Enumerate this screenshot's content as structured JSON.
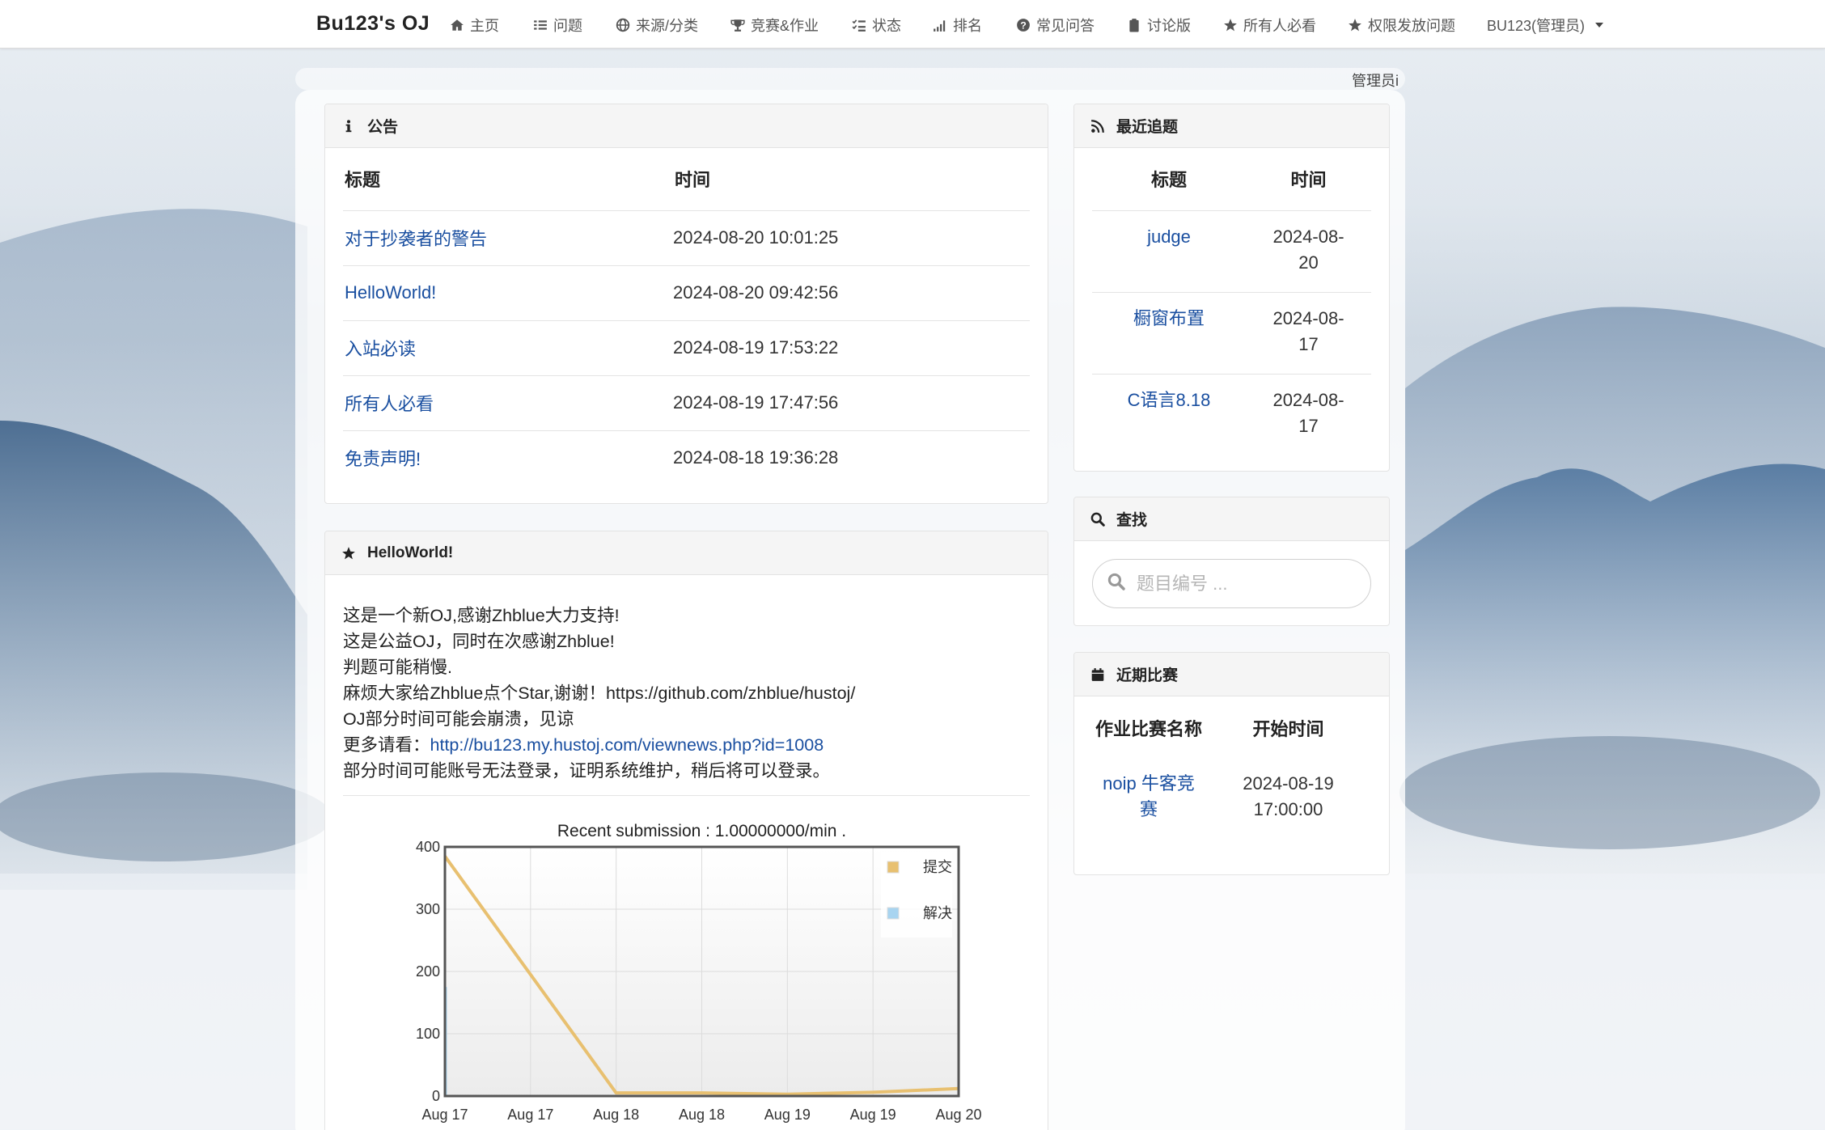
{
  "navbar": {
    "brand": "Bu123's OJ",
    "items": [
      {
        "label": "主页",
        "icon": "home-icon"
      },
      {
        "label": "问题",
        "icon": "list-icon"
      },
      {
        "label": "来源/分类",
        "icon": "globe-icon"
      },
      {
        "label": "竞赛&作业",
        "icon": "trophy-icon"
      },
      {
        "label": "状态",
        "icon": "tasks-icon"
      },
      {
        "label": "排名",
        "icon": "signal-icon"
      },
      {
        "label": "常见问答",
        "icon": "question-icon"
      },
      {
        "label": "讨论版",
        "icon": "clipboard-icon"
      },
      {
        "label": "所有人必看",
        "icon": "star-icon"
      },
      {
        "label": "权限发放问题",
        "icon": "star-icon"
      }
    ],
    "user": "BU123(管理员)"
  },
  "marquee": "管理员i",
  "notice": {
    "title": "公告",
    "col_title": "标题",
    "col_time": "时间",
    "rows": [
      {
        "title": "对于抄袭者的警告",
        "time": "2024-08-20 10:01:25"
      },
      {
        "title": "HelloWorld!",
        "time": "2024-08-20 09:42:56"
      },
      {
        "title": "入站必读",
        "time": "2024-08-19 17:53:22"
      },
      {
        "title": "所有人必看",
        "time": "2024-08-19 17:47:56"
      },
      {
        "title": "免责声明!",
        "time": "2024-08-18 19:36:28"
      }
    ]
  },
  "hello": {
    "title": "HelloWorld!",
    "lines": [
      "这是一个新OJ,感谢Zhblue大力支持!",
      "这是公益OJ，同时在次感谢Zhblue!",
      "判题可能稍慢.",
      "麻烦大家给Zhblue点个Star,谢谢！https://github.com/zhblue/hustoj/",
      "OJ部分时间可能会崩溃，见谅"
    ],
    "more_label": "更多请看：",
    "more_link": "http://bu123.my.hustoj.com/viewnews.php?id=1008",
    "last_line": "部分时间可能账号无法登录，证明系统维护，稍后将可以登录。"
  },
  "discussion": {
    "title": "最近追题",
    "col_title": "标题",
    "col_time": "时间",
    "rows": [
      {
        "title": "judge",
        "date_a": "2024-08-",
        "date_b": "20"
      },
      {
        "title": "橱窗布置",
        "date_a": "2024-08-",
        "date_b": "17"
      },
      {
        "title": "C语言8.18",
        "date_a": "2024-08-",
        "date_b": "17"
      }
    ]
  },
  "search": {
    "title": "查找",
    "placeholder": "题目编号 ..."
  },
  "contests": {
    "title": "近期比赛",
    "col_name": "作业比赛名称",
    "col_start": "开始时间",
    "rows": [
      {
        "name_a": "noip 牛客竞",
        "name_b": "赛",
        "start_a": "2024-08-19",
        "start_b": "17:00:00"
      }
    ]
  },
  "colors": {
    "link": "#1a4fa0",
    "submit_series": "#e8c070",
    "solved_series": "#a8d4f0"
  },
  "chart_data": {
    "type": "line",
    "title": "Recent submission : 1.00000000/min .",
    "x": [
      "Aug 17",
      "Aug 17",
      "Aug 18",
      "Aug 18",
      "Aug 19",
      "Aug 19",
      "Aug 20"
    ],
    "ylim": [
      0,
      400
    ],
    "yticks": [
      0,
      100,
      200,
      300,
      400
    ],
    "legend_position": "top-right",
    "series": [
      {
        "name": "提交",
        "values": [
          385,
          195,
          5,
          5,
          3,
          6,
          12
        ]
      },
      {
        "name": "解决",
        "values": [
          175,
          0,
          0,
          0,
          0,
          0,
          0
        ]
      }
    ]
  }
}
